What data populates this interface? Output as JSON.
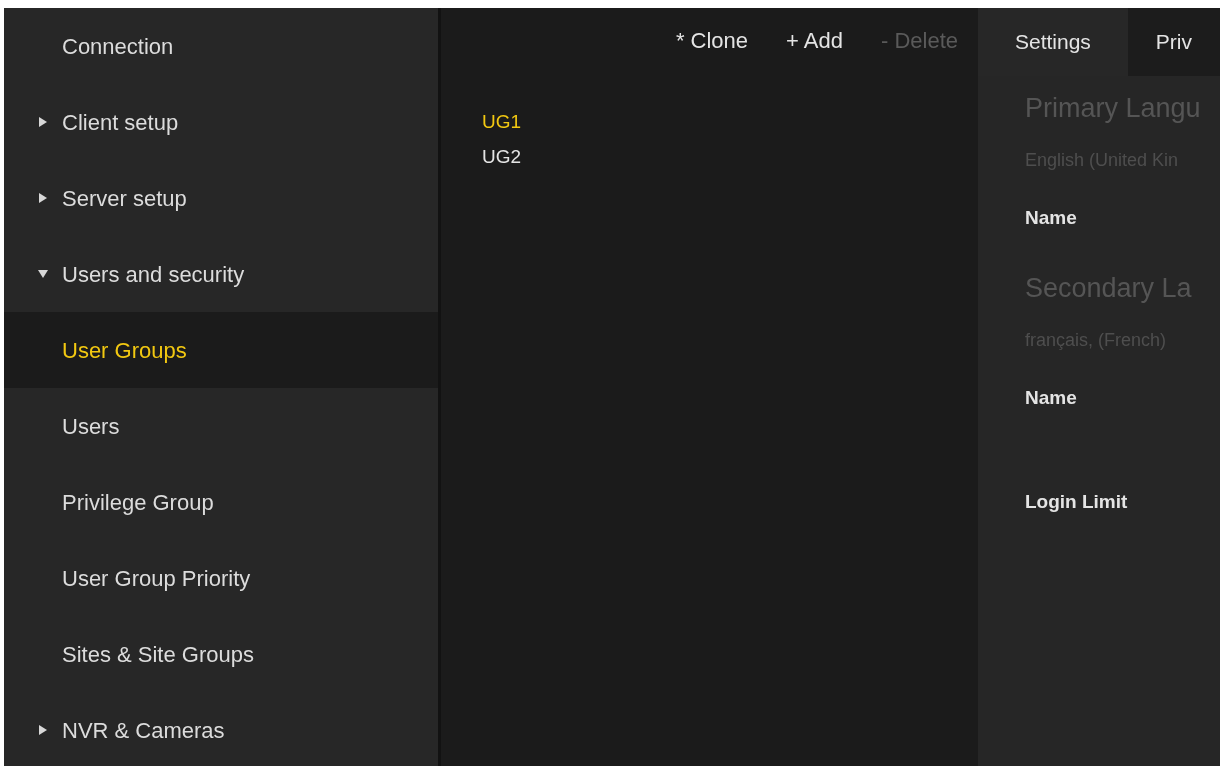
{
  "sidebar": {
    "items": [
      {
        "label": "Connection",
        "selected": false
      },
      {
        "label": "Client setup",
        "expanded": false,
        "selected": false
      },
      {
        "label": "Server setup",
        "expanded": false,
        "selected": false
      },
      {
        "label": "Users and security",
        "expanded": true,
        "selected": false,
        "children": [
          {
            "label": "User Groups",
            "selected": true
          },
          {
            "label": "Users",
            "selected": false
          },
          {
            "label": "Privilege Group",
            "selected": false
          },
          {
            "label": "User Group Priority",
            "selected": false
          },
          {
            "label": "Sites & Site Groups",
            "selected": false
          }
        ]
      },
      {
        "label": "NVR & Cameras",
        "expanded": false,
        "selected": false
      }
    ]
  },
  "toolbar": [
    {
      "label": "* Clone",
      "disabled": false
    },
    {
      "label": "+ Add",
      "disabled": false
    },
    {
      "label": "- Delete",
      "disabled": true
    }
  ],
  "user_groups": [
    {
      "label": "UG1",
      "selected": true
    },
    {
      "label": "UG2",
      "selected": false
    }
  ],
  "tabs": [
    {
      "label": "Settings",
      "selected": true
    },
    {
      "label": "Priv",
      "selected": false
    }
  ],
  "settings": {
    "languages": [
      {
        "heading": "Primary Langu",
        "value": "English (United Kin",
        "field_label": "Name"
      },
      {
        "heading": "Secondary La",
        "value": "français, (French)",
        "field_label": "Name"
      }
    ],
    "login_limit_label": "Login Limit"
  }
}
